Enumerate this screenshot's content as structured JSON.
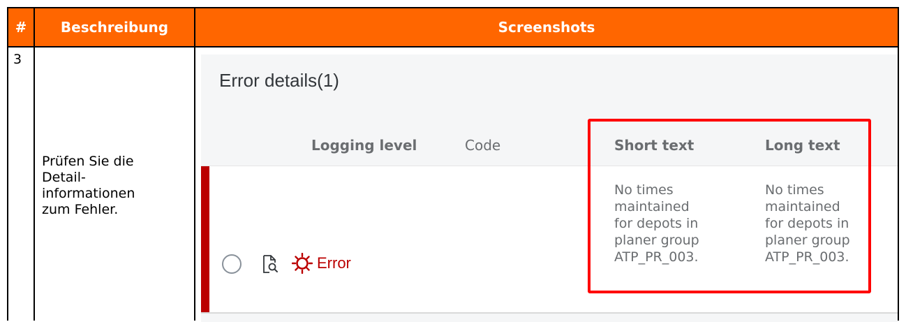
{
  "table": {
    "header": {
      "num": "#",
      "description": "Beschreibung",
      "screenshots": "Screenshots"
    },
    "row": {
      "number": "3",
      "description": "Prüfen Sie die\nDetail-\ninformationen\nzum Fehler."
    }
  },
  "screenshot": {
    "title": "Error details(1)",
    "columns": {
      "logging_level": "Logging level",
      "code": "Code",
      "short_text": "Short text",
      "long_text": "Long text"
    },
    "entries": [
      {
        "logging_level": "Error",
        "short_text": [
          "No times",
          "maintained",
          "for depots in",
          "planer group",
          "ATP_PR_003."
        ],
        "long_text": [
          "No times",
          "maintained",
          "for depots in",
          "planer group",
          "ATP_PR_003."
        ]
      }
    ],
    "icons": {
      "row_select": "radio-button-icon",
      "detail": "document-detail-icon",
      "error": "error-icon"
    },
    "colors": {
      "header_bg": "#ff6600",
      "error": "#bb0000",
      "highlight": "#ff0000"
    }
  }
}
